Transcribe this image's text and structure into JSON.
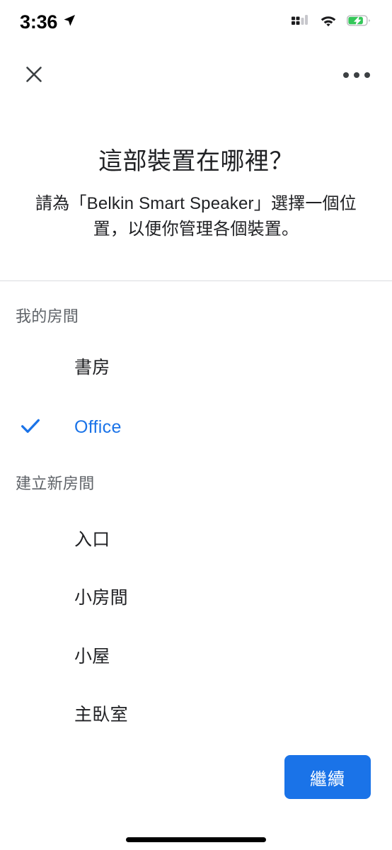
{
  "status_bar": {
    "time": "3:36",
    "location_icon": "location-arrow-icon",
    "signal_icon": "cellular-signal-icon",
    "wifi_icon": "wifi-icon",
    "battery_icon": "battery-charging-icon"
  },
  "nav": {
    "close_icon": "close-icon",
    "overflow_icon": "more-options-icon"
  },
  "header": {
    "title": "這部裝置在哪裡？",
    "subtitle": "請為「Belkin Smart Speaker」選擇一個位置，以便你管理各個裝置。",
    "device_name": "Belkin Smart Speaker"
  },
  "sections": [
    {
      "header": "我的房間",
      "rooms": [
        {
          "label": "書房",
          "selected": false
        },
        {
          "label": "Office",
          "selected": true
        }
      ]
    },
    {
      "header": "建立新房間",
      "rooms": [
        {
          "label": "入口",
          "selected": false
        },
        {
          "label": "小房間",
          "selected": false
        },
        {
          "label": "小屋",
          "selected": false
        },
        {
          "label": "主臥室",
          "selected": false
        }
      ]
    }
  ],
  "footer": {
    "continue_label": "繼續"
  },
  "colors": {
    "accent_blue": "#1a73e8",
    "text_primary": "#202124",
    "text_secondary": "#5f6368",
    "divider": "#dadce0",
    "battery_green": "#34c759"
  }
}
